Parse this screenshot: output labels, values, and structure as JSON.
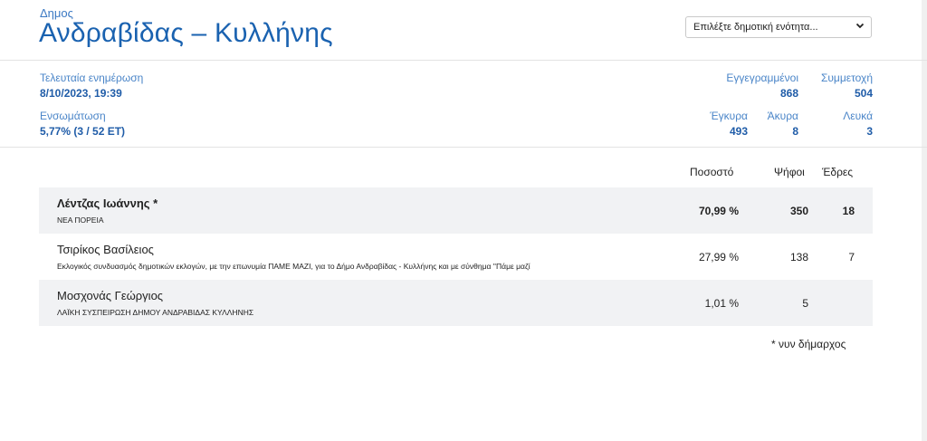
{
  "header": {
    "kicker": "Δημος",
    "title": "Ανδραβίδας – Κυλλήνης",
    "select_placeholder": "Επιλέξτε δημοτική ενότητα..."
  },
  "summary": {
    "updated_label": "Τελευταία ενημέρωση",
    "updated_value": "8/10/2023, 19:39",
    "integration_label": "Ενσωμάτωση",
    "integration_value": "5,77% (3 / 52 ΕΤ)",
    "registered_label": "Εγγεγραμμένοι",
    "registered_value": "868",
    "turnout_label": "Συμμετοχή",
    "turnout_value": "504",
    "valid_label": "Έγκυρα",
    "valid_value": "493",
    "invalid_label": "Άκυρα",
    "invalid_value": "8",
    "blank_label": "Λευκά",
    "blank_value": "3"
  },
  "table": {
    "headers": {
      "percent": "Ποσοστό",
      "votes": "Ψήφοι",
      "seats": "Έδρες"
    },
    "rows": [
      {
        "name": "Λέντζας Ιωάννης  *",
        "party": "ΝΕΑ ΠΟΡΕΙΑ",
        "percent": "70,99 %",
        "votes": "350",
        "seats": "18"
      },
      {
        "name": "Τσιρίκος Βασίλειος",
        "party": "Εκλογικός συνδυασμός δημοτικών εκλογών, με την επωνυμία ΠΑΜΕ ΜΑΖΙ, για το Δήμο Ανδραβίδας - Κυλλήνης και με σύνθημα ''Πάμε μαζί",
        "percent": "27,99 %",
        "votes": "138",
        "seats": "7"
      },
      {
        "name": "Μοσχονάς Γεώργιος",
        "party": "ΛΑΪΚΗ ΣΥΣΠΕΙΡΩΣΗ ΔΗΜΟΥ ΑΝΔΡΑΒΙΔΑΣ ΚΥΛΛΗΝΗΣ",
        "percent": "1,01 %",
        "votes": "5",
        "seats": ""
      }
    ],
    "footnote": "* νυν δήμαρχος"
  }
}
